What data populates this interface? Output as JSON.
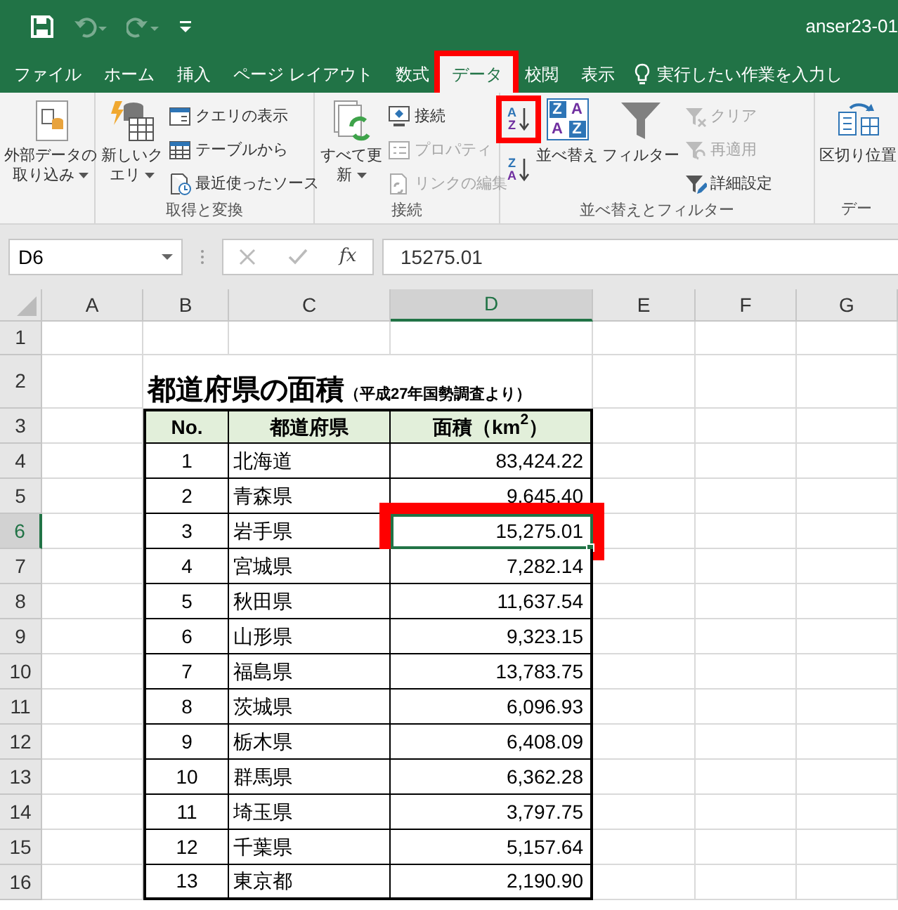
{
  "title_bar": {
    "quick_access": [
      {
        "kind": "save",
        "disabled": false
      },
      {
        "kind": "undo",
        "disabled": true
      },
      {
        "kind": "redo",
        "disabled": true
      },
      {
        "kind": "customize",
        "disabled": false
      }
    ],
    "document_title": "anser23-01"
  },
  "ribbon_tabs": [
    {
      "label": "ファイル",
      "selected": false,
      "highlighted": false
    },
    {
      "label": "ホーム",
      "selected": false,
      "highlighted": false
    },
    {
      "label": "挿入",
      "selected": false,
      "highlighted": false
    },
    {
      "label": "ページ レイアウト",
      "selected": false,
      "highlighted": false
    },
    {
      "label": "数式",
      "selected": false,
      "highlighted": false
    },
    {
      "label": "データ",
      "selected": true,
      "highlighted": true
    },
    {
      "label": "校閲",
      "selected": false,
      "highlighted": false
    },
    {
      "label": "表示",
      "selected": false,
      "highlighted": false
    }
  ],
  "tell_me": "実行したい作業を入力し",
  "ribbon_groups": [
    {
      "items": [
        {
          "kind": "large",
          "label": "外部データの取り込み",
          "dropdown": true,
          "disabled": false,
          "highlighted": false
        }
      ]
    },
    {
      "label": "取得と変換",
      "items": [
        {
          "kind": "large",
          "label": "新しいクエリ",
          "dropdown": true,
          "disabled": false,
          "highlighted": false
        },
        {
          "kind": "small",
          "label": "クエリの表示",
          "disabled": false,
          "highlighted": false
        },
        {
          "kind": "small",
          "label": "テーブルから",
          "disabled": false,
          "highlighted": false
        },
        {
          "kind": "small",
          "label": "最近使ったソース",
          "disabled": false,
          "highlighted": false
        }
      ]
    },
    {
      "label": "接続",
      "items": [
        {
          "kind": "large",
          "label": "すべて更新",
          "dropdown": true,
          "disabled": false,
          "highlighted": false
        },
        {
          "kind": "small",
          "label": "接続",
          "disabled": false,
          "highlighted": false
        },
        {
          "kind": "small",
          "label": "プロパティ",
          "disabled": true,
          "highlighted": false
        },
        {
          "kind": "small",
          "label": "リンクの編集",
          "disabled": true,
          "highlighted": false
        }
      ]
    },
    {
      "label": "並べ替えとフィルター",
      "items": [
        {
          "kind": "sort",
          "glyphs": [
            "A",
            "Z"
          ],
          "disabled": false,
          "highlighted": true
        },
        {
          "kind": "sort",
          "glyphs": [
            "Z",
            "A"
          ],
          "disabled": false,
          "highlighted": false
        },
        {
          "kind": "sortbig",
          "label": "並べ替え",
          "glyphs": [
            "Z",
            "A",
            "A",
            "Z"
          ],
          "disabled": false,
          "highlighted": false
        },
        {
          "kind": "large",
          "label": "フィルター",
          "disabled": false,
          "highlighted": false
        },
        {
          "kind": "small",
          "label": "クリア",
          "disabled": true,
          "highlighted": false
        },
        {
          "kind": "small",
          "label": "再適用",
          "disabled": true,
          "highlighted": false
        },
        {
          "kind": "small",
          "label": "詳細設定",
          "disabled": false,
          "highlighted": false
        }
      ]
    },
    {
      "label": "デー",
      "items": [
        {
          "kind": "large",
          "label": "区切り位置",
          "disabled": false
        }
      ]
    }
  ],
  "formula_bar": {
    "name_box": "D6",
    "function_label": "fx",
    "value": "15275.01"
  },
  "sheet": {
    "columns": [
      {
        "label": "A",
        "selected": false
      },
      {
        "label": "B",
        "selected": false
      },
      {
        "label": "C",
        "selected": false
      },
      {
        "label": "D",
        "selected": true
      },
      {
        "label": "E",
        "selected": false
      },
      {
        "label": "F",
        "selected": false
      },
      {
        "label": "G",
        "selected": false
      }
    ],
    "row_headers": [
      {
        "label": "1",
        "selected": false
      },
      {
        "label": "2",
        "selected": false
      },
      {
        "label": "3",
        "selected": false
      },
      {
        "label": "4",
        "selected": false
      },
      {
        "label": "5",
        "selected": false
      },
      {
        "label": "6",
        "selected": true
      },
      {
        "label": "7",
        "selected": false
      },
      {
        "label": "8",
        "selected": false
      },
      {
        "label": "9",
        "selected": false
      },
      {
        "label": "10",
        "selected": false
      },
      {
        "label": "11",
        "selected": false
      },
      {
        "label": "12",
        "selected": false
      },
      {
        "label": "13",
        "selected": false
      },
      {
        "label": "14",
        "selected": false
      },
      {
        "label": "15",
        "selected": false
      },
      {
        "label": "16",
        "selected": false
      }
    ],
    "title": "都道府県の面積",
    "subtitle": "（平成27年国勢調査より）",
    "table": {
      "columns": [
        "No.",
        "都道府県",
        "面積（km$^{2}$）"
      ],
      "rows": [
        {
          "no": "1",
          "prefecture": "北海道",
          "area": "83,424.22",
          "selected": false,
          "highlighted": false
        },
        {
          "no": "2",
          "prefecture": "青森県",
          "area": "9,645.40",
          "selected": false,
          "highlighted": false
        },
        {
          "no": "3",
          "prefecture": "岩手県",
          "area": "15,275.01",
          "selected": true,
          "highlighted": true
        },
        {
          "no": "4",
          "prefecture": "宮城県",
          "area": "7,282.14",
          "selected": false,
          "highlighted": false
        },
        {
          "no": "5",
          "prefecture": "秋田県",
          "area": "11,637.54",
          "selected": false,
          "highlighted": false
        },
        {
          "no": "6",
          "prefecture": "山形県",
          "area": "9,323.15",
          "selected": false,
          "highlighted": false
        },
        {
          "no": "7",
          "prefecture": "福島県",
          "area": "13,783.75",
          "selected": false,
          "highlighted": false
        },
        {
          "no": "8",
          "prefecture": "茨城県",
          "area": "6,096.93",
          "selected": false,
          "highlighted": false
        },
        {
          "no": "9",
          "prefecture": "栃木県",
          "area": "6,408.09",
          "selected": false,
          "highlighted": false
        },
        {
          "no": "10",
          "prefecture": "群馬県",
          "area": "6,362.28",
          "selected": false,
          "highlighted": false
        },
        {
          "no": "11",
          "prefecture": "埼玉県",
          "area": "3,797.75",
          "selected": false,
          "highlighted": false
        },
        {
          "no": "12",
          "prefecture": "千葉県",
          "area": "5,157.64",
          "selected": false,
          "highlighted": false
        },
        {
          "no": "13",
          "prefecture": "東京都",
          "area": "2,190.90",
          "selected": false,
          "highlighted": false
        }
      ]
    }
  }
}
